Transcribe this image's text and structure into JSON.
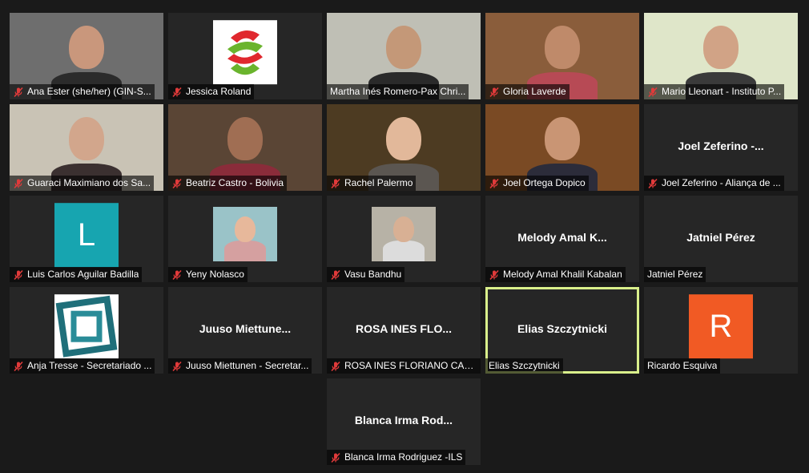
{
  "colors": {
    "background": "#1a1a1a",
    "tile": "#262626",
    "active_speaker_border": "#d9ef8b",
    "mute_red": "#e03a3a"
  },
  "participants": [
    {
      "label": "Ana Ester (she/her) (GIN-S...",
      "muted": true,
      "kind": "video",
      "bg": "#6e6e6e",
      "skin": "#c9977c",
      "shirt": "#2b2b2b"
    },
    {
      "label": "Jessica Roland",
      "muted": true,
      "kind": "logo",
      "logo_name": "red-green-swirl-logo"
    },
    {
      "label": "Martha Inés Romero-Pax Chri...",
      "muted": false,
      "kind": "video",
      "bg": "#bfbfb5",
      "skin": "#c49878",
      "shirt": "#2a2a2a"
    },
    {
      "label": "Gloria Laverde",
      "muted": true,
      "kind": "video",
      "bg": "#8a5d3b",
      "skin": "#bf8a6a",
      "shirt": "#b74a55"
    },
    {
      "label": "Mario Lleonart - Instituto P...",
      "muted": true,
      "kind": "video",
      "bg": "#dfe6c9",
      "skin": "#d1a386",
      "shirt": "#3a3a3a"
    },
    {
      "label": "Guaraci Maximiano dos Sa...",
      "muted": true,
      "kind": "video",
      "bg": "#c9c3b5",
      "skin": "#d2a68c",
      "shirt": "#3b3030"
    },
    {
      "label": "Beatriz Castro - Bolivia",
      "muted": true,
      "kind": "video",
      "bg": "#5a4535",
      "skin": "#a06e53",
      "shirt": "#8a2c3a"
    },
    {
      "label": "Rachel Palermo",
      "muted": true,
      "kind": "video",
      "bg": "#4d3b22",
      "skin": "#e2b89a",
      "shirt": "#5b5651"
    },
    {
      "label": "Joel Ortega Dopico",
      "muted": true,
      "kind": "video",
      "bg": "#7a4a24",
      "skin": "#c99574",
      "shirt": "#2c2c3a"
    },
    {
      "label": "Joel Zeferino - Aliança de ...",
      "muted": true,
      "kind": "name",
      "display": "Joel Zeferino -..."
    },
    {
      "label": "Luis Carlos Aguilar Badilla",
      "muted": true,
      "kind": "avatar",
      "letter": "L",
      "avatar_color": "#17a5b0"
    },
    {
      "label": "Yeny Nolasco",
      "muted": true,
      "kind": "photo",
      "bg": "#9ac3c8",
      "skin": "#e7b89b",
      "shirt": "#d5a0a0"
    },
    {
      "label": "Vasu Bandhu",
      "muted": true,
      "kind": "photo",
      "bg": "#b7b2a6",
      "skin": "#d8b094",
      "shirt": "#dcdcdc"
    },
    {
      "label": "Melody Amal Khalil Kabalan",
      "muted": true,
      "kind": "name",
      "display": "Melody Amal K..."
    },
    {
      "label": "Jatniel Pérez",
      "muted": false,
      "kind": "name",
      "display": "Jatniel Pérez"
    },
    {
      "label": "Anja Tresse - Secretariado ...",
      "muted": true,
      "kind": "logo",
      "logo_name": "teal-squares-logo"
    },
    {
      "label": "Juuso Miettunen - Secretar...",
      "muted": true,
      "kind": "name",
      "display": "Juuso Miettune..."
    },
    {
      "label": "ROSA INES FLORIANO CAR...",
      "muted": true,
      "kind": "name",
      "display": "ROSA INES FLO..."
    },
    {
      "label": "Elias Szczytnicki",
      "muted": false,
      "kind": "name",
      "display": "Elias Szczytnicki",
      "active": true
    },
    {
      "label": "Ricardo Esquiva",
      "muted": false,
      "kind": "avatar",
      "letter": "R",
      "avatar_color": "#f15a24"
    },
    {
      "label": "Blanca Irma Rodriguez -ILS",
      "muted": true,
      "kind": "name",
      "display": "Blanca Irma Rod..."
    }
  ]
}
